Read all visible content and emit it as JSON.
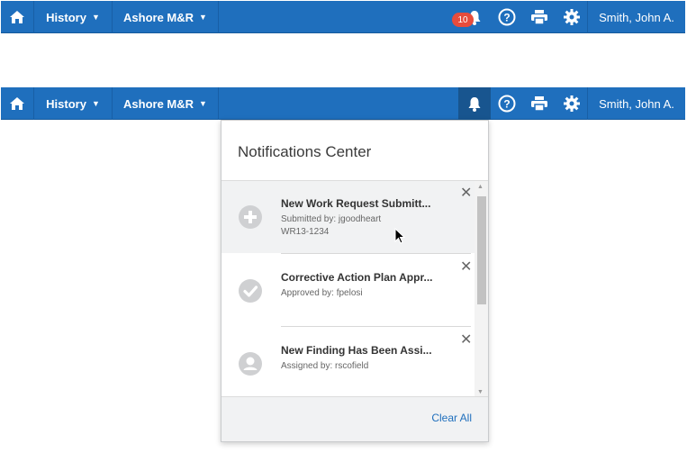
{
  "navbar": {
    "history_label": "History",
    "site_label": "Ashore M&R",
    "user_name": "Smith, John A.",
    "notification_count": "10"
  },
  "notifications_center": {
    "title": "Notifications Center",
    "items": [
      {
        "title": "New Work Request Submitt...",
        "line1": "Submitted by: jgoodheart",
        "line2": "WR13-1234",
        "icon": "plus-circle-icon"
      },
      {
        "title": "Corrective Action Plan Appr...",
        "line1": "Approved by: fpelosi",
        "icon": "check-circle-icon"
      },
      {
        "title": "New Finding Has Been Assi...",
        "line1": "Assigned by: rscofield",
        "icon": "user-circle-icon"
      }
    ],
    "clear_all_label": "Clear All"
  }
}
